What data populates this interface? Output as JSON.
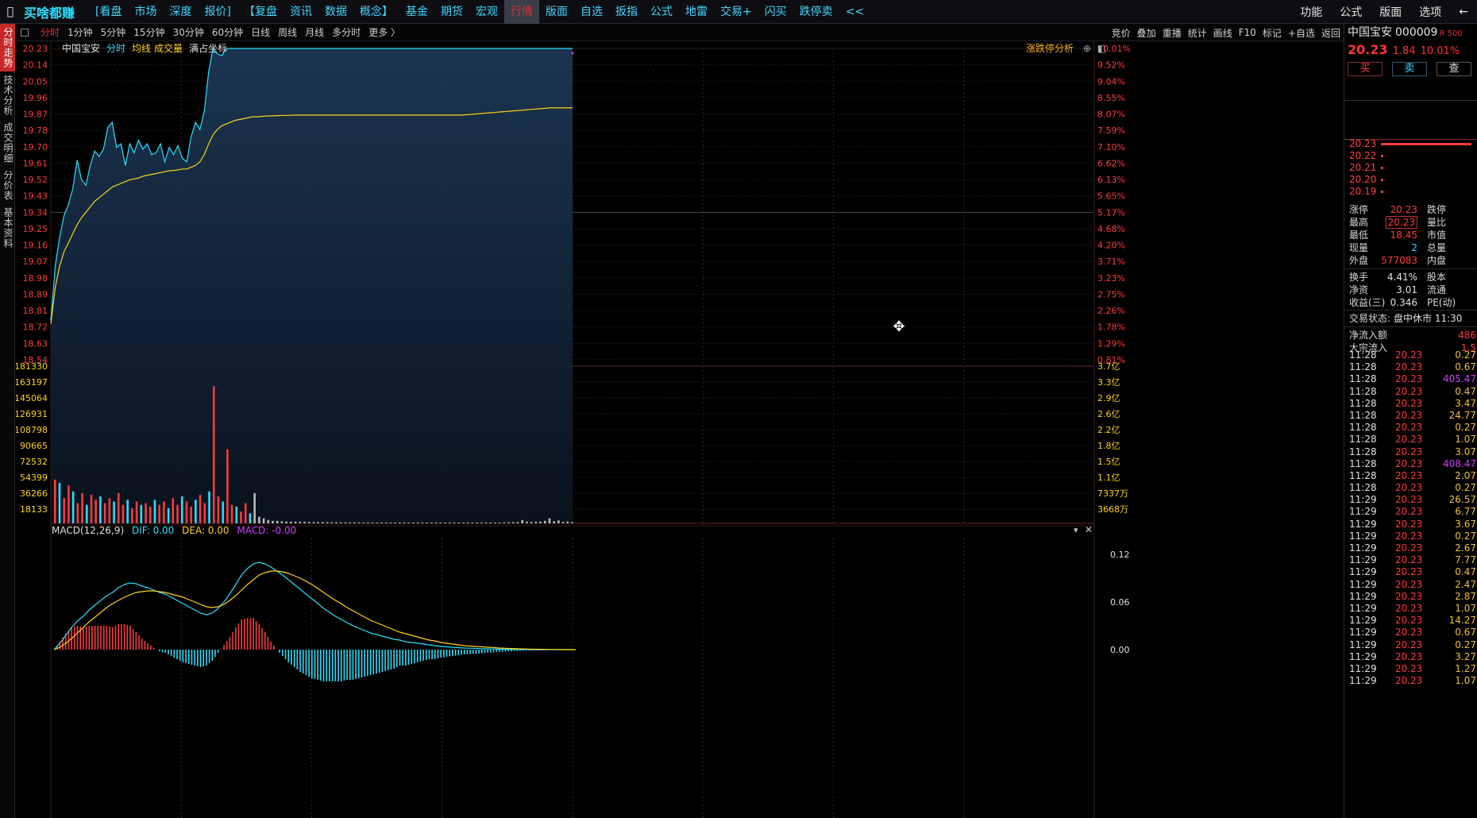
{
  "brand": "买啥都赚",
  "menu": [
    "[看盘",
    "市场",
    "深度",
    "报价]",
    "【复盘",
    "资讯",
    "数据",
    "概念】",
    "基金",
    "期货",
    "宏观",
    "行情",
    "版面",
    "自选",
    "扳指",
    "公式",
    "地雷",
    "交易+",
    "闪买",
    "跌停卖",
    "<<"
  ],
  "menu_active": 11,
  "menu_right": [
    "功能",
    "公式",
    "版面",
    "选项",
    "←"
  ],
  "side_tabs": [
    "分时走势",
    "技术分析",
    "成交明细",
    "分价表",
    "基本资料"
  ],
  "toolbar": [
    "分时",
    "1分钟",
    "5分钟",
    "15分钟",
    "30分钟",
    "60分钟",
    "日线",
    "周线",
    "月线",
    "多分时",
    "更多 〉"
  ],
  "toolbar_right": [
    "竞价",
    "叠加",
    "重播",
    "统计",
    "画线",
    "F10",
    "标记",
    "+自选",
    "返回"
  ],
  "chart_info": {
    "name": "中国宝安",
    "items": [
      "分时",
      "均线",
      "成交量",
      "满占坐标"
    ]
  },
  "limit_analysis": "涨跌停分析",
  "price_axis": [
    "20.23",
    "20.14",
    "20.05",
    "19.96",
    "19.87",
    "19.78",
    "19.70",
    "19.61",
    "19.52",
    "19.43",
    "19.34",
    "19.25",
    "19.16",
    "19.07",
    "18.98",
    "18.89",
    "18.81",
    "18.72",
    "18.63",
    "18.54"
  ],
  "pct_axis": [
    "10.01%",
    "9.52%",
    "9.04%",
    "8.55%",
    "8.07%",
    "7.59%",
    "7.10%",
    "6.62%",
    "6.13%",
    "5.65%",
    "5.17%",
    "4.68%",
    "4.20%",
    "3.71%",
    "3.23%",
    "2.75%",
    "2.26%",
    "1.78%",
    "1.29%",
    "0.81%"
  ],
  "vol_axis_left": [
    "181330",
    "163197",
    "145064",
    "126931",
    "108798",
    "90665",
    "72532",
    "54399",
    "36266",
    "18133"
  ],
  "vol_axis_right": [
    "3.7亿",
    "3.3亿",
    "2.9亿",
    "2.6亿",
    "2.2亿",
    "1.8亿",
    "1.5亿",
    "1.1亿",
    "7337万",
    "3668万"
  ],
  "macd": {
    "title": "MACD(12,26,9)",
    "dif": "DIF: 0.00",
    "dea": "DEA: 0.00",
    "macd": "MACD: -0.00",
    "axis": [
      "0.12",
      "0.06",
      "0.00"
    ]
  },
  "chart_data": {
    "type": "line",
    "price_line": [
      18.72,
      19.02,
      19.18,
      19.3,
      19.36,
      19.45,
      19.61,
      19.5,
      19.47,
      19.58,
      19.66,
      19.63,
      19.67,
      19.79,
      19.82,
      19.68,
      19.7,
      19.58,
      19.7,
      19.65,
      19.72,
      19.67,
      19.7,
      19.64,
      19.65,
      19.7,
      19.6,
      19.68,
      19.64,
      19.69,
      19.62,
      19.6,
      19.74,
      19.82,
      19.78,
      19.88,
      20.1,
      20.23,
      20.2,
      20.19,
      20.23,
      20.23,
      20.23,
      20.23,
      20.23,
      20.23,
      20.23,
      20.23,
      20.23,
      20.23,
      20.23,
      20.23,
      20.23,
      20.23,
      20.23,
      20.23,
      20.23,
      20.23,
      20.23,
      20.23,
      20.23,
      20.23,
      20.23,
      20.23,
      20.23,
      20.23,
      20.23,
      20.23,
      20.23,
      20.23,
      20.23,
      20.23,
      20.23,
      20.23,
      20.23,
      20.23,
      20.23,
      20.23,
      20.23,
      20.23,
      20.23,
      20.23,
      20.23,
      20.23,
      20.23,
      20.23,
      20.23,
      20.23,
      20.23,
      20.23,
      20.23,
      20.23,
      20.23,
      20.23,
      20.23,
      20.23,
      20.23,
      20.23,
      20.23,
      20.23,
      20.23,
      20.23,
      20.23,
      20.23,
      20.23,
      20.23,
      20.23,
      20.23,
      20.23,
      20.23,
      20.23,
      20.23,
      20.23,
      20.23,
      20.23,
      20.23,
      20.23,
      20.23,
      20.23,
      20.23
    ],
    "avg_line": [
      18.7,
      18.9,
      19.02,
      19.1,
      19.15,
      19.2,
      19.25,
      19.29,
      19.32,
      19.35,
      19.38,
      19.4,
      19.42,
      19.44,
      19.46,
      19.47,
      19.48,
      19.49,
      19.5,
      19.505,
      19.51,
      19.52,
      19.525,
      19.53,
      19.535,
      19.54,
      19.545,
      19.55,
      19.552,
      19.555,
      19.56,
      19.56,
      19.57,
      19.58,
      19.6,
      19.64,
      19.7,
      19.75,
      19.78,
      19.8,
      19.81,
      19.82,
      19.83,
      19.835,
      19.84,
      19.845,
      19.85,
      19.85,
      19.852,
      19.854,
      19.855,
      19.856,
      19.857,
      19.858,
      19.858,
      19.859,
      19.86,
      19.86,
      19.86,
      19.86,
      19.86,
      19.86,
      19.86,
      19.86,
      19.86,
      19.86,
      19.86,
      19.86,
      19.86,
      19.86,
      19.86,
      19.86,
      19.86,
      19.86,
      19.86,
      19.86,
      19.86,
      19.86,
      19.86,
      19.86,
      19.86,
      19.86,
      19.86,
      19.86,
      19.86,
      19.86,
      19.86,
      19.86,
      19.86,
      19.86,
      19.86,
      19.86,
      19.86,
      19.86,
      19.86,
      19.862,
      19.864,
      19.866,
      19.868,
      19.87,
      19.872,
      19.874,
      19.876,
      19.878,
      19.88,
      19.882,
      19.884,
      19.886,
      19.888,
      19.89,
      19.892,
      19.894,
      19.896,
      19.898,
      19.9,
      19.9,
      19.9,
      19.9,
      19.9,
      19.9
    ],
    "volume": [
      52000,
      48000,
      30000,
      45000,
      38000,
      24000,
      36000,
      22000,
      34000,
      28000,
      32000,
      24000,
      30000,
      26000,
      36000,
      22000,
      28000,
      18000,
      26000,
      22000,
      24000,
      20000,
      28000,
      22000,
      26000,
      18000,
      30000,
      22000,
      32000,
      26000,
      20000,
      28000,
      34000,
      24000,
      38000,
      163000,
      32000,
      26000,
      88000,
      22000,
      20000,
      14000,
      24000,
      12000,
      36000,
      8000,
      6000,
      4000,
      3000,
      3000,
      2500,
      2200,
      2000,
      2000,
      1800,
      1800,
      1600,
      1500,
      1500,
      1400,
      1400,
      1300,
      1300,
      1200,
      1200,
      1100,
      1100,
      1100,
      1000,
      1000,
      1000,
      1000,
      1000,
      1000,
      1000,
      1000,
      1000,
      1000,
      1000,
      1000,
      1000,
      1000,
      1000,
      1000,
      1000,
      1000,
      1000,
      1000,
      1000,
      1000,
      1000,
      1000,
      1000,
      1000,
      1000,
      1000,
      1000,
      1000,
      1000,
      1200,
      1300,
      1400,
      1500,
      4000,
      2000,
      1600,
      1800,
      2000,
      3000,
      6000,
      2500,
      3500,
      1800,
      2200,
      1500
    ],
    "dif": [
      0.0,
      0.008,
      0.018,
      0.028,
      0.036,
      0.042,
      0.05,
      0.056,
      0.062,
      0.068,
      0.072,
      0.078,
      0.082,
      0.084,
      0.083,
      0.08,
      0.078,
      0.075,
      0.072,
      0.07,
      0.066,
      0.062,
      0.058,
      0.054,
      0.05,
      0.046,
      0.044,
      0.046,
      0.052,
      0.06,
      0.07,
      0.082,
      0.094,
      0.102,
      0.108,
      0.11,
      0.108,
      0.104,
      0.099,
      0.094,
      0.088,
      0.082,
      0.076,
      0.07,
      0.064,
      0.058,
      0.052,
      0.047,
      0.042,
      0.038,
      0.034,
      0.03,
      0.027,
      0.024,
      0.021,
      0.019,
      0.017,
      0.015,
      0.013,
      0.012,
      0.01,
      0.009,
      0.008,
      0.007,
      0.006,
      0.005,
      0.004,
      0.0035,
      0.003,
      0.0025,
      0.002,
      0.0018,
      0.0015,
      0.0012,
      0.001,
      0.0008,
      0.0006,
      0.0005,
      0.0004,
      0.0003,
      0.0002,
      0.0001,
      0.0,
      0.0,
      0.0,
      0.0,
      0.0,
      0.0,
      0.0,
      0.0
    ],
    "dea": [
      0.0,
      0.003,
      0.008,
      0.014,
      0.021,
      0.028,
      0.035,
      0.041,
      0.047,
      0.053,
      0.058,
      0.062,
      0.066,
      0.069,
      0.072,
      0.073,
      0.074,
      0.074,
      0.073,
      0.072,
      0.07,
      0.068,
      0.066,
      0.063,
      0.06,
      0.057,
      0.054,
      0.053,
      0.054,
      0.057,
      0.062,
      0.068,
      0.075,
      0.082,
      0.088,
      0.094,
      0.097,
      0.099,
      0.099,
      0.098,
      0.096,
      0.093,
      0.09,
      0.086,
      0.082,
      0.077,
      0.072,
      0.067,
      0.062,
      0.058,
      0.053,
      0.049,
      0.045,
      0.041,
      0.037,
      0.034,
      0.031,
      0.028,
      0.025,
      0.022,
      0.02,
      0.018,
      0.016,
      0.014,
      0.012,
      0.011,
      0.009,
      0.008,
      0.007,
      0.006,
      0.005,
      0.0045,
      0.004,
      0.0035,
      0.003,
      0.0025,
      0.002,
      0.0017,
      0.0014,
      0.0011,
      0.0009,
      0.0007,
      0.0005,
      0.0004,
      0.0003,
      0.0002,
      0.0002,
      0.0001,
      0.0001,
      0.0
    ]
  },
  "right_panel": {
    "name": "中国宝安",
    "code": "000009",
    "badge": "R 500",
    "price": "20.23",
    "change": "1.84",
    "pct": "10.01%",
    "buttons": [
      "买",
      "卖",
      "查"
    ],
    "book": [
      {
        "p": "20.23",
        "w": 0.95
      },
      {
        "p": "20.22",
        "w": 0.015
      },
      {
        "p": "20.21",
        "w": 0.015
      },
      {
        "p": "20.20",
        "w": 0.015
      },
      {
        "p": "20.19",
        "w": 0.015
      }
    ],
    "quote": [
      {
        "k": "涨停",
        "v": "20.23",
        "c": "#ff3b3b",
        "k2": "跌停"
      },
      {
        "k": "最高",
        "v": "20.23",
        "c": "#ff3b3b",
        "k2": "量比",
        "box": true
      },
      {
        "k": "最低",
        "v": "18.45",
        "c": "#ff3b3b",
        "k2": "市值"
      },
      {
        "k": "现量",
        "v": "2",
        "c": "#3fd6ff",
        "k2": "总量"
      },
      {
        "k": "外盘",
        "v": "577083",
        "c": "#ff3b3b",
        "k2": "内盘"
      },
      {
        "sep": true
      },
      {
        "k": "换手",
        "v": "4.41%",
        "c": "#e0e0e0",
        "k2": "股本"
      },
      {
        "k": "净资",
        "v": "3.01",
        "c": "#e0e0e0",
        "k2": "流通"
      },
      {
        "k": "收益(三)",
        "v": "0.346",
        "c": "#e0e0e0",
        "k2": "PE(动)"
      }
    ],
    "status_label": "交易状态:",
    "status_value": "盘中休市 11:30",
    "flows": [
      {
        "k": "净流入额",
        "v": "486"
      },
      {
        "k": "大宗流入",
        "v": "1.5"
      }
    ],
    "ticks": [
      {
        "t": "11:28",
        "p": "20.23",
        "v": "0.27"
      },
      {
        "t": "11:28",
        "p": "20.23",
        "v": "0.67"
      },
      {
        "t": "11:28",
        "p": "20.23",
        "v": "405.47",
        "big": true
      },
      {
        "t": "11:28",
        "p": "20.23",
        "v": "0.47"
      },
      {
        "t": "11:28",
        "p": "20.23",
        "v": "3.47"
      },
      {
        "t": "11:28",
        "p": "20.23",
        "v": "24.77"
      },
      {
        "t": "11:28",
        "p": "20.23",
        "v": "0.27"
      },
      {
        "t": "11:28",
        "p": "20.23",
        "v": "1.07"
      },
      {
        "t": "11:28",
        "p": "20.23",
        "v": "3.07"
      },
      {
        "t": "11:28",
        "p": "20.23",
        "v": "408.47",
        "big": true
      },
      {
        "t": "11:28",
        "p": "20.23",
        "v": "2.07"
      },
      {
        "t": "11:28",
        "p": "20.23",
        "v": "0.27"
      },
      {
        "t": "11:29",
        "p": "20.23",
        "v": "26.57"
      },
      {
        "t": "11:29",
        "p": "20.23",
        "v": "6.77"
      },
      {
        "t": "11:29",
        "p": "20.23",
        "v": "3.67"
      },
      {
        "t": "11:29",
        "p": "20.23",
        "v": "0.27"
      },
      {
        "t": "11:29",
        "p": "20.23",
        "v": "2.67"
      },
      {
        "t": "11:29",
        "p": "20.23",
        "v": "7.77"
      },
      {
        "t": "11:29",
        "p": "20.23",
        "v": "0.47"
      },
      {
        "t": "11:29",
        "p": "20.23",
        "v": "2.47"
      },
      {
        "t": "11:29",
        "p": "20.23",
        "v": "2.87"
      },
      {
        "t": "11:29",
        "p": "20.23",
        "v": "1.07"
      },
      {
        "t": "11:29",
        "p": "20.23",
        "v": "14.27"
      },
      {
        "t": "11:29",
        "p": "20.23",
        "v": "0.67"
      },
      {
        "t": "11:29",
        "p": "20.23",
        "v": "0.27"
      },
      {
        "t": "11:29",
        "p": "20.23",
        "v": "3.27"
      },
      {
        "t": "11:29",
        "p": "20.23",
        "v": "1.27"
      },
      {
        "t": "11:29",
        "p": "20.23",
        "v": "1.07"
      }
    ]
  },
  "colors": {
    "price": "#29e0ff",
    "avg": "#ffd21a",
    "up": "#ff3b3b",
    "down": "#29e0ff",
    "grid": "#3a1e1e"
  }
}
